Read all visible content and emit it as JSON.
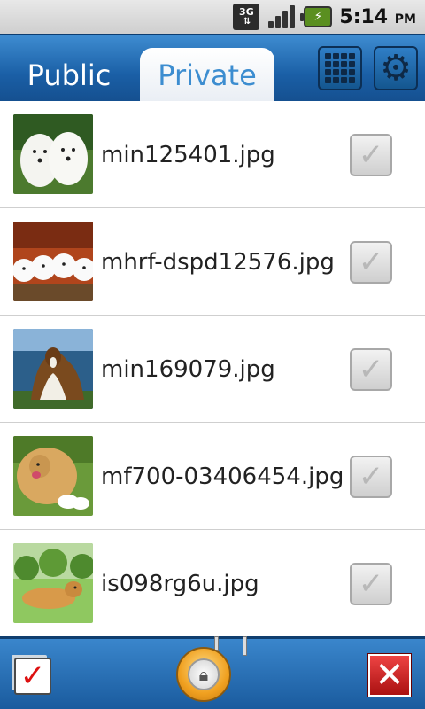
{
  "status_bar": {
    "network": "3G",
    "time": "5:14",
    "ampm": "PM"
  },
  "tabs": [
    {
      "label": "Public",
      "selected": false
    },
    {
      "label": "Private",
      "selected": true
    }
  ],
  "header_buttons": {
    "grid_icon": "grid-view-icon",
    "settings_icon": "gear-icon"
  },
  "files": [
    {
      "name": "min125401.jpg",
      "checked": false,
      "thumb": "two-white-puppies"
    },
    {
      "name": "mhrf-dspd12576.jpg",
      "checked": false,
      "thumb": "four-white-puppies"
    },
    {
      "name": "min169079.jpg",
      "checked": false,
      "thumb": "collie"
    },
    {
      "name": "mf700-03406454.jpg",
      "checked": false,
      "thumb": "golden-retriever-with-puppies"
    },
    {
      "name": "is098rg6u.jpg",
      "checked": false,
      "thumb": "golden-retriever-on-grass"
    }
  ],
  "bottom_bar": {
    "select_all_icon": "select-all-checkbox-icon",
    "lock_icon": "lock-icon",
    "close_icon": "close-icon"
  },
  "colors": {
    "header_blue": "#1a5fa6",
    "tab_text_selected": "#3c8dd0",
    "close_red": "#cc2222",
    "lock_orange": "#f0a020"
  }
}
